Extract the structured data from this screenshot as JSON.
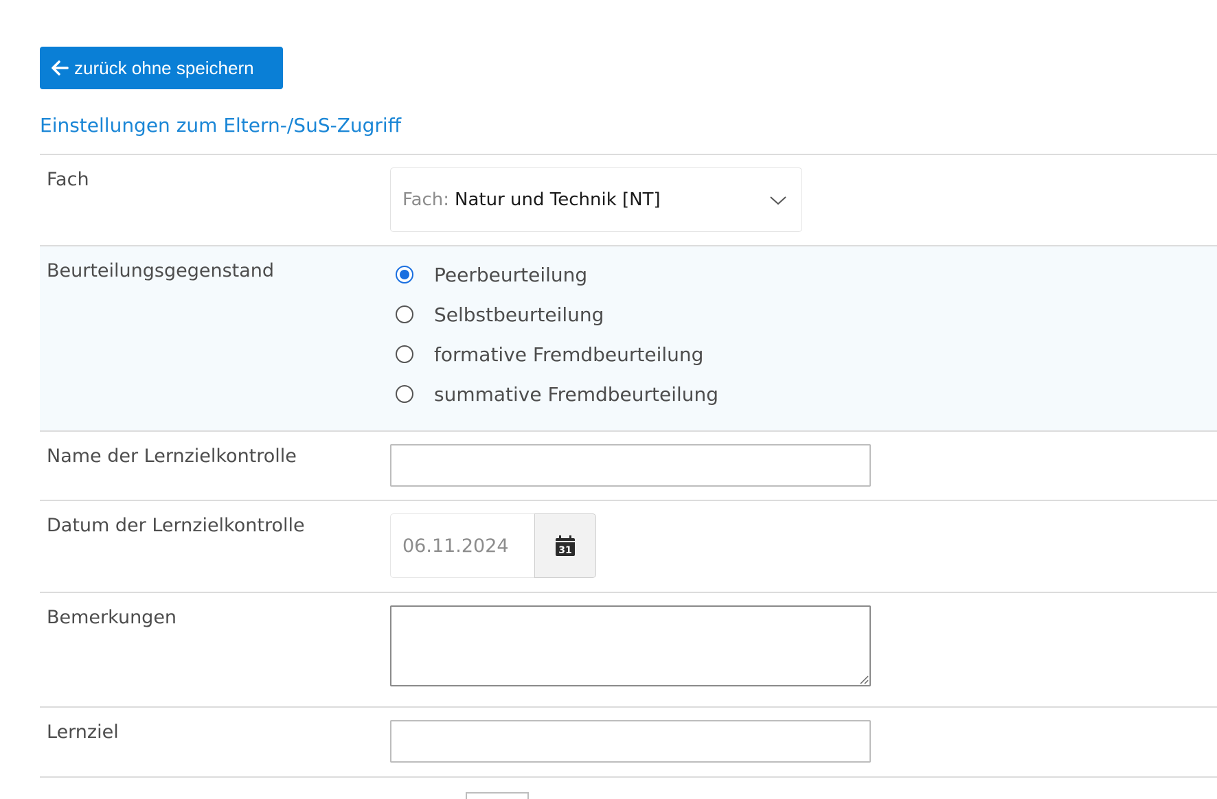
{
  "toolbar": {
    "back_label": "zurück ohne speichern"
  },
  "section": {
    "title": "Einstellungen zum Eltern-/SuS-Zugriff"
  },
  "form": {
    "fach": {
      "label": "Fach",
      "prefix": "Fach:",
      "value": "Natur und Technik [NT]"
    },
    "beurteilung": {
      "label": "Beurteilungsgegenstand",
      "options": [
        {
          "label": "Peerbeurteilung",
          "checked": true
        },
        {
          "label": "Selbstbeurteilung",
          "checked": false
        },
        {
          "label": "formative Fremdbeurteilung",
          "checked": false
        },
        {
          "label": "summative Fremdbeurteilung",
          "checked": false
        }
      ]
    },
    "name": {
      "label": "Name der Lernzielkontrolle",
      "value": ""
    },
    "datum": {
      "label": "Datum der Lernzielkontrolle",
      "value": "06.11.2024",
      "calendar_day": "31"
    },
    "bemerkungen": {
      "label": "Bemerkungen",
      "value": ""
    },
    "lernziel": {
      "label": "Lernziel",
      "value": ""
    }
  },
  "icons": {
    "back": "arrow-left-icon",
    "dropdown": "chevron-down-icon",
    "calendar": "calendar-icon"
  },
  "colors": {
    "primary": "#0a7fd6",
    "link": "#1a86d6",
    "radio_checked": "#1a6fe0",
    "row_highlight": "#f5fafd"
  }
}
